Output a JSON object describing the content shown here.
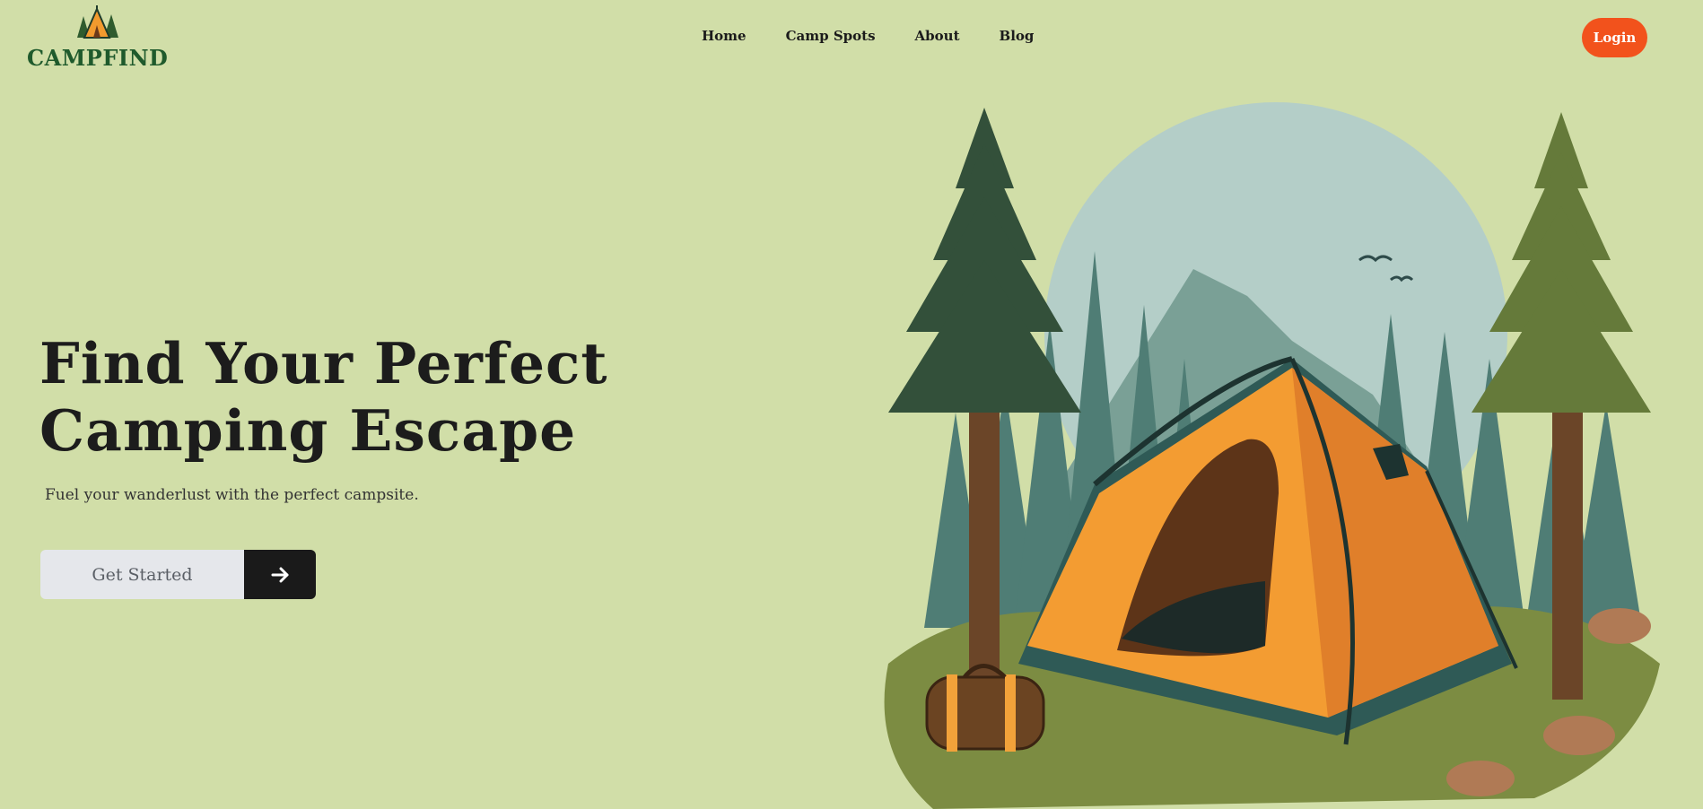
{
  "brand": {
    "name": "CAMPFIND"
  },
  "nav": {
    "items": [
      "Home",
      "Camp Spots",
      "About",
      "Blog"
    ]
  },
  "auth": {
    "login_label": "Login"
  },
  "hero": {
    "title": "Find Your Perfect Camping Escape",
    "subtitle": "Fuel your wanderlust with the perfect campsite.",
    "cta_label": "Get Started"
  },
  "icons": {
    "logo": "tent-trees-logo-icon",
    "cta": "arrow-right-icon"
  },
  "colors": {
    "background": "#d1dea8",
    "brand": "#1f5a2c",
    "accent": "#f2521c",
    "cta_dark": "#1a1a1a"
  }
}
